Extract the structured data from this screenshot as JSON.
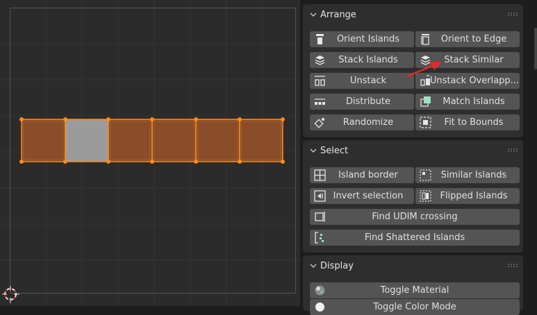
{
  "icons": {
    "orient_islands": "orient-islands-icon",
    "orient_to_edge": "orient-to-edge-icon",
    "stack_islands": "stack-islands-icon",
    "stack_similar": "stack-similar-icon",
    "unstack": "unstack-icon",
    "unstack_overlapping": "unstack-overlapping-icon",
    "distribute": "distribute-icon",
    "match_islands": "match-islands-icon",
    "randomize": "randomize-icon",
    "fit_to_bounds": "fit-to-bounds-icon",
    "island_border": "island-border-icon",
    "similar_islands": "similar-islands-icon",
    "invert_selection": "invert-selection-icon",
    "flipped_islands": "flipped-islands-icon",
    "find_udim_crossing": "find-udim-crossing-icon",
    "find_shattered_islands": "find-shattered-islands-icon",
    "toggle_material": "toggle-material-icon",
    "toggle_color_mode": "toggle-color-mode-icon",
    "cursor_2d": "2d-cursor-icon",
    "annotation_arrow": "red-arrow-icon"
  },
  "colors": {
    "island_fill": "#8a4d29",
    "island_selected_face": "#9b9b9b",
    "vertex_orange": "#ff8c1a",
    "annotation_arrow": "#e8262a",
    "button_bg": "#545454",
    "panel_bg": "#2e2e2e"
  },
  "viewport": {
    "island_faces": [
      "unselected",
      "selected",
      "unselected",
      "unselected",
      "unselected",
      "unselected"
    ]
  },
  "panels": {
    "arrange": {
      "title": "Arrange",
      "expanded": true,
      "buttons": {
        "orient_islands": "Orient Islands",
        "orient_to_edge": "Orient to Edge",
        "stack_islands": "Stack Islands",
        "stack_similar": "Stack Similar",
        "unstack": "Unstack",
        "unstack_overlapping": "Unstack Overlapp...",
        "distribute": "Distribute",
        "match_islands": "Match Islands",
        "randomize": "Randomize",
        "fit_to_bounds": "Fit to Bounds"
      }
    },
    "select": {
      "title": "Select",
      "expanded": true,
      "buttons": {
        "island_border": "Island border",
        "similar_islands": "Similar Islands",
        "invert_selection": "Invert selection",
        "flipped_islands": "Flipped Islands",
        "find_udim_crossing": "Find UDIM crossing",
        "find_shattered_islands": "Find Shattered Islands"
      }
    },
    "display": {
      "title": "Display",
      "expanded": true,
      "buttons": {
        "toggle_material": "Toggle Material",
        "toggle_color_mode": "Toggle Color Mode"
      }
    }
  }
}
